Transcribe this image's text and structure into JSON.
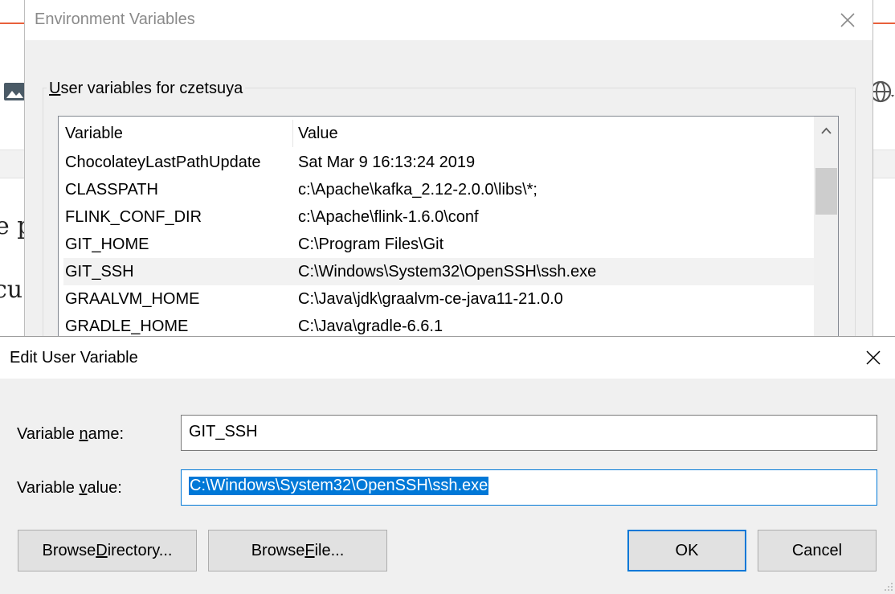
{
  "background": {
    "text_fragment_1": "e p",
    "text_fragment_2": "cu",
    "colors": {
      "accent": "#e8603c"
    }
  },
  "env_dialog": {
    "title": "Environment Variables",
    "user_vars_group": {
      "label_prefix": "U",
      "label_rest": "ser variables for czetsuya"
    },
    "columns": {
      "variable": "Variable",
      "value": "Value"
    },
    "rows": [
      {
        "name": "ChocolateyLastPathUpdate",
        "value": "Sat Mar  9 16:13:24 2019"
      },
      {
        "name": "CLASSPATH",
        "value": "c:\\Apache\\kafka_2.12-2.0.0\\libs\\*;"
      },
      {
        "name": "FLINK_CONF_DIR",
        "value": "c:\\Apache\\flink-1.6.0\\conf"
      },
      {
        "name": "GIT_HOME",
        "value": "C:\\Program Files\\Git"
      },
      {
        "name": "GIT_SSH",
        "value": "C:\\Windows\\System32\\OpenSSH\\ssh.exe"
      },
      {
        "name": "GRAALVM_HOME",
        "value": "C:\\Java\\jdk\\graalvm-ce-java11-21.0.0"
      },
      {
        "name": "GRADLE_HOME",
        "value": "C:\\Java\\gradle-6.6.1"
      }
    ],
    "selected_row": "GIT_SSH"
  },
  "edit_dialog": {
    "title": "Edit User Variable",
    "name_label": {
      "before": "Variable ",
      "underlined": "n",
      "after": "ame:"
    },
    "value_label": {
      "before": "Variable ",
      "underlined": "v",
      "after": "alue:"
    },
    "name_value": "GIT_SSH",
    "value_value": "C:\\Windows\\System32\\OpenSSH\\ssh.exe",
    "buttons": {
      "browse_directory": {
        "before": "Browse ",
        "underlined": "D",
        "after": "irectory..."
      },
      "browse_file": {
        "before": "Browse ",
        "underlined": "F",
        "after": "ile..."
      },
      "ok": "OK",
      "cancel": "Cancel"
    },
    "colors": {
      "selection": "#0078d7",
      "focus_border": "#0078d7"
    }
  }
}
